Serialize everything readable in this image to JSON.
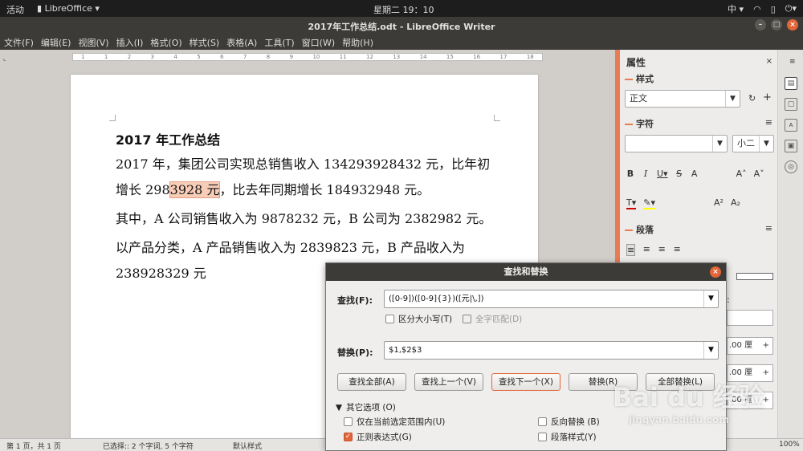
{
  "topbar": {
    "activities": "活动",
    "app_name": "LibreOffice",
    "clock": "星期二 19：10",
    "input_method": "中"
  },
  "window": {
    "title": "2017年工作总结.odt - LibreOffice Writer"
  },
  "menu": [
    "文件(F)",
    "编辑(E)",
    "视图(V)",
    "插入(I)",
    "格式(O)",
    "样式(S)",
    "表格(A)",
    "工具(T)",
    "窗口(W)",
    "帮助(H)"
  ],
  "ruler_ticks": [
    "1",
    "1",
    "2",
    "3",
    "4",
    "5",
    "6",
    "7",
    "8",
    "9",
    "10",
    "11",
    "12",
    "13",
    "14",
    "15",
    "16",
    "17",
    "18"
  ],
  "document": {
    "heading": "2017 年工作总结",
    "p1_before": "2017 年，集团公司实现总销售收入 134293928432 元，比年初增长 298",
    "p1_highlight": "3928 元",
    "p1_after": "，比去年同期增长 184932948 元。",
    "p2": "其中，A 公司销售收入为 9878232 元，B 公司为 2382982 元。",
    "p3": "以产品分类，A 产品销售收入为 2839823 元，B 产品收入为 238928329 元"
  },
  "sidebar": {
    "title": "属性",
    "style_section": "样式",
    "style_value": "正文",
    "char_section": "字符",
    "font_name": "",
    "font_size": "小二",
    "para_section": "段落",
    "spacing_value": ".00 厘",
    "colon": ":"
  },
  "statusbar": {
    "page": "第 1 页，共 1 页",
    "selection": "已选择:: 2 个字词, 5 个字符",
    "style": "默认样式",
    "zoom": "100%"
  },
  "dialog": {
    "title": "查找和替换",
    "find_label": "查找(F):",
    "find_value": "([0-9])([0-9]{3})([元|\\,])",
    "match_case": "区分大小写(T)",
    "whole_words": "全字匹配(D)",
    "replace_label": "替换(P):",
    "replace_value": "$1,$2$3",
    "buttons": {
      "find_all": "查找全部(A)",
      "find_prev": "查找上一个(V)",
      "find_next": "查找下一个(X)",
      "replace": "替换(R)",
      "replace_all": "全部替换(L)"
    },
    "other_options": "其它选项 (O)",
    "current_selection": "仅在当前选定范围内(U)",
    "regex": "正则表达式(G)",
    "backwards": "反向替换 (B)",
    "para_styles": "段落样式(Y)"
  },
  "watermark": {
    "logo": "Bai du 经验",
    "url": "jingyan.baidu.com"
  },
  "colors": {
    "accent": "#e2653a",
    "highlight": "#f7cdb8"
  }
}
